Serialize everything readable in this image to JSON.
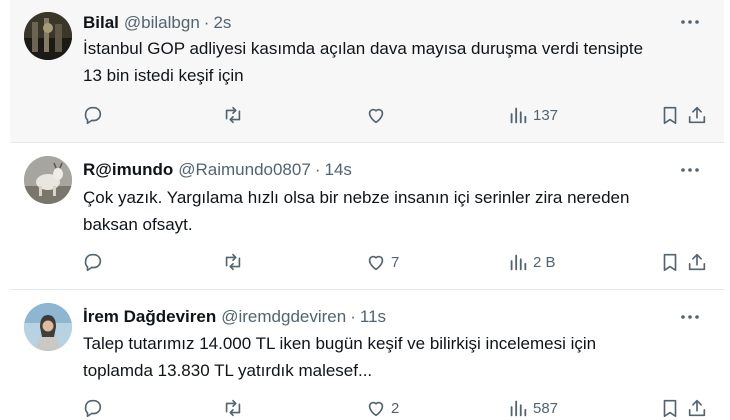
{
  "tweets": [
    {
      "name": "Bilal",
      "handle": "@bilalbgn",
      "dot": "·",
      "time": "2s",
      "text_line1": "İstanbul GOP adliyesi kasımda açılan dava mayısa duruşma verdi tensipte",
      "text_line2": "13 bin istedi keşif için",
      "likes": "",
      "views": "137",
      "avatar": "avatar-dark-scene"
    },
    {
      "name": "R@imundo",
      "handle": "@Raimundo0807",
      "dot": "·",
      "time": "14s",
      "text_line1": "Çok yazık. Yargılama hızlı olsa bir nebze insanın içi serinler zira nereden",
      "text_line2": "baksan ofsayt.",
      "likes": "7",
      "views": "2 B",
      "avatar": "avatar-goat"
    },
    {
      "name": "İrem Dağdeviren",
      "handle": "@iremdgdeviren",
      "dot": "·",
      "time": "11s",
      "text_line1": "Talep tutarımız 14.000 TL iken bugün keşif ve bilirkişi incelemesi için",
      "text_line2": "toplamda 13.830 TL yatırdık malesef...",
      "likes": "2",
      "views": "587",
      "avatar": "avatar-person"
    }
  ],
  "colors": {
    "text": "#0f1419",
    "muted": "#536471",
    "highlight_bg": "#f7f7f7",
    "separator": "#e6e9eb"
  },
  "icons": [
    "reply-icon",
    "retweet-icon",
    "like-icon",
    "views-icon",
    "bookmark-icon",
    "share-icon",
    "more-icon"
  ]
}
